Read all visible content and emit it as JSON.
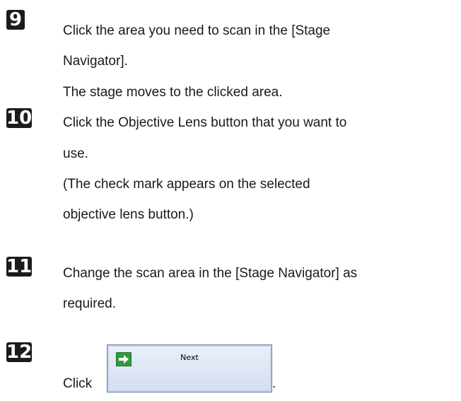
{
  "steps": [
    {
      "number": "9",
      "lines": [
        "Click the area you need to scan in the [Stage",
        "Navigator].",
        "The stage moves to the clicked area."
      ]
    },
    {
      "number": "10",
      "lines": [
        "Click the Objective Lens button that you want to",
        "use.",
        "(The check mark appears on the selected",
        "objective lens button.)"
      ]
    },
    {
      "number": "11",
      "lines": [
        "Change the scan area in the [Stage Navigator] as",
        "required."
      ]
    },
    {
      "number": "12",
      "lines": [
        "Click",
        "."
      ]
    }
  ],
  "next_button": {
    "label": "Next",
    "icon": "right-arrow-icon",
    "accent": "#2f9d3a"
  }
}
